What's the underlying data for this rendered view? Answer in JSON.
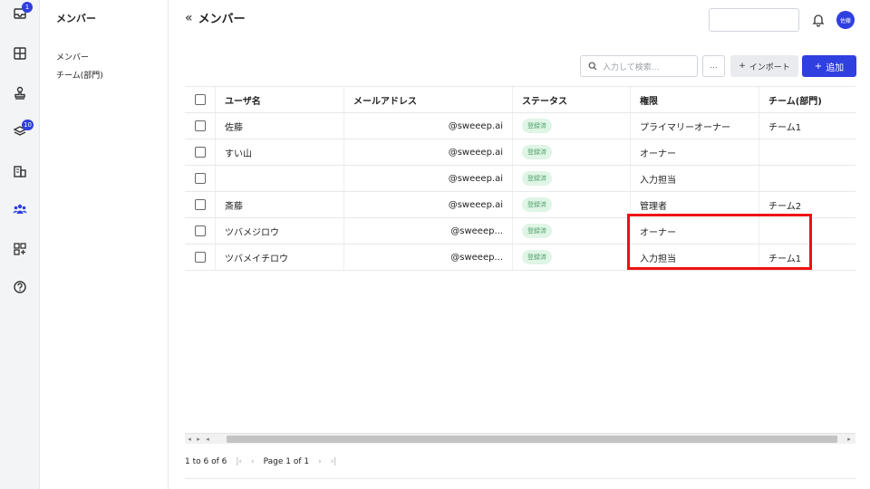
{
  "rail": {
    "items": [
      {
        "icon": "inbox-icon",
        "badge": "1"
      },
      {
        "icon": "layout-grid-icon",
        "badge": ""
      },
      {
        "icon": "stamp-icon",
        "badge": ""
      },
      {
        "icon": "layers-icon",
        "badge": "10"
      },
      {
        "icon": "building-icon",
        "badge": ""
      },
      {
        "icon": "users-icon",
        "badge": ""
      },
      {
        "icon": "apps-add-icon",
        "badge": ""
      },
      {
        "icon": "help-icon",
        "badge": ""
      }
    ],
    "active_color": "#2f3fe0"
  },
  "subnav": {
    "title": "メンバー",
    "items": [
      "メンバー",
      "チーム(部門)"
    ]
  },
  "header": {
    "title": "メンバー",
    "avatar_text": "佐藤"
  },
  "toolbar": {
    "search_placeholder": "入力して検索...",
    "more_label": "...",
    "import_label": "インポート",
    "add_label": "追加"
  },
  "table": {
    "columns": [
      "ユーザ名",
      "メールアドレス",
      "ステータス",
      "権限",
      "チーム(部門)"
    ],
    "rows": [
      {
        "name": "佐藤",
        "email": "@sweeep.ai",
        "status": "登録済",
        "role": "プライマリーオーナー",
        "team": "チーム1"
      },
      {
        "name": "すい山",
        "email": "@sweeep.ai",
        "status": "登録済",
        "role": "オーナー",
        "team": ""
      },
      {
        "name": "",
        "email": "@sweeep.ai",
        "status": "登録済",
        "role": "入力担当",
        "team": ""
      },
      {
        "name": "斎藤",
        "email": "@sweeep.ai",
        "status": "登録済",
        "role": "管理者",
        "team": "チーム2"
      },
      {
        "name": "ツバメジロウ",
        "email": "@sweeep...",
        "status": "登録済",
        "role": "オーナー",
        "team": ""
      },
      {
        "name": "ツバメイチロウ",
        "email": "@sweeep...",
        "status": "登録済",
        "role": "入力担当",
        "team": "チーム1"
      }
    ]
  },
  "pager": {
    "range": "1 to 6 of 6",
    "page_label": "Page 1 of 1"
  }
}
